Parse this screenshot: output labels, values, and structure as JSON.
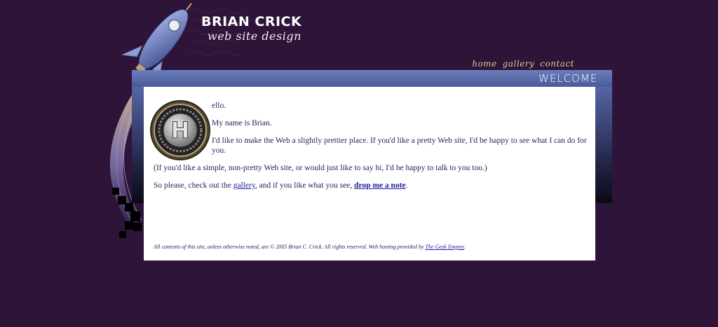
{
  "brand": {
    "title": "BRIAN CRICK",
    "subtitle": "web site design"
  },
  "nav": {
    "items": [
      {
        "label": "home"
      },
      {
        "label": "gallery"
      },
      {
        "label": "contact"
      }
    ]
  },
  "section": {
    "title": "WELCOME"
  },
  "content": {
    "intro": "ello.",
    "name_line": "My name is Brian.",
    "pitch": "I'd like to make the Web a slightly prettier place. If you'd like a pretty Web site, I'd be happy to see what I can do for you.",
    "simple": "(If you'd like a simple, non-pretty Web site, or would just like to say hi, I'd be happy to talk to you too.)",
    "cta_prefix": "So please, check out the ",
    "cta_gallery_link": "gallery",
    "cta_middle": ", and if you like what you see, ",
    "cta_note_link": "drop me a note",
    "cta_suffix": ".",
    "badge_letter": "H"
  },
  "footer": {
    "text": "All contents of this site, unless otherwise noted, are © 2005 Brian C. Crick. All rights reserved. Web hosting provided by ",
    "link": "The Geek Empire",
    "suffix": "."
  },
  "colors": {
    "page_bg": "#2d1438",
    "frame_blue": "#5b6cad",
    "nav_text": "#e8c39a",
    "body_text": "#26235a",
    "link": "#1a1aa0"
  }
}
